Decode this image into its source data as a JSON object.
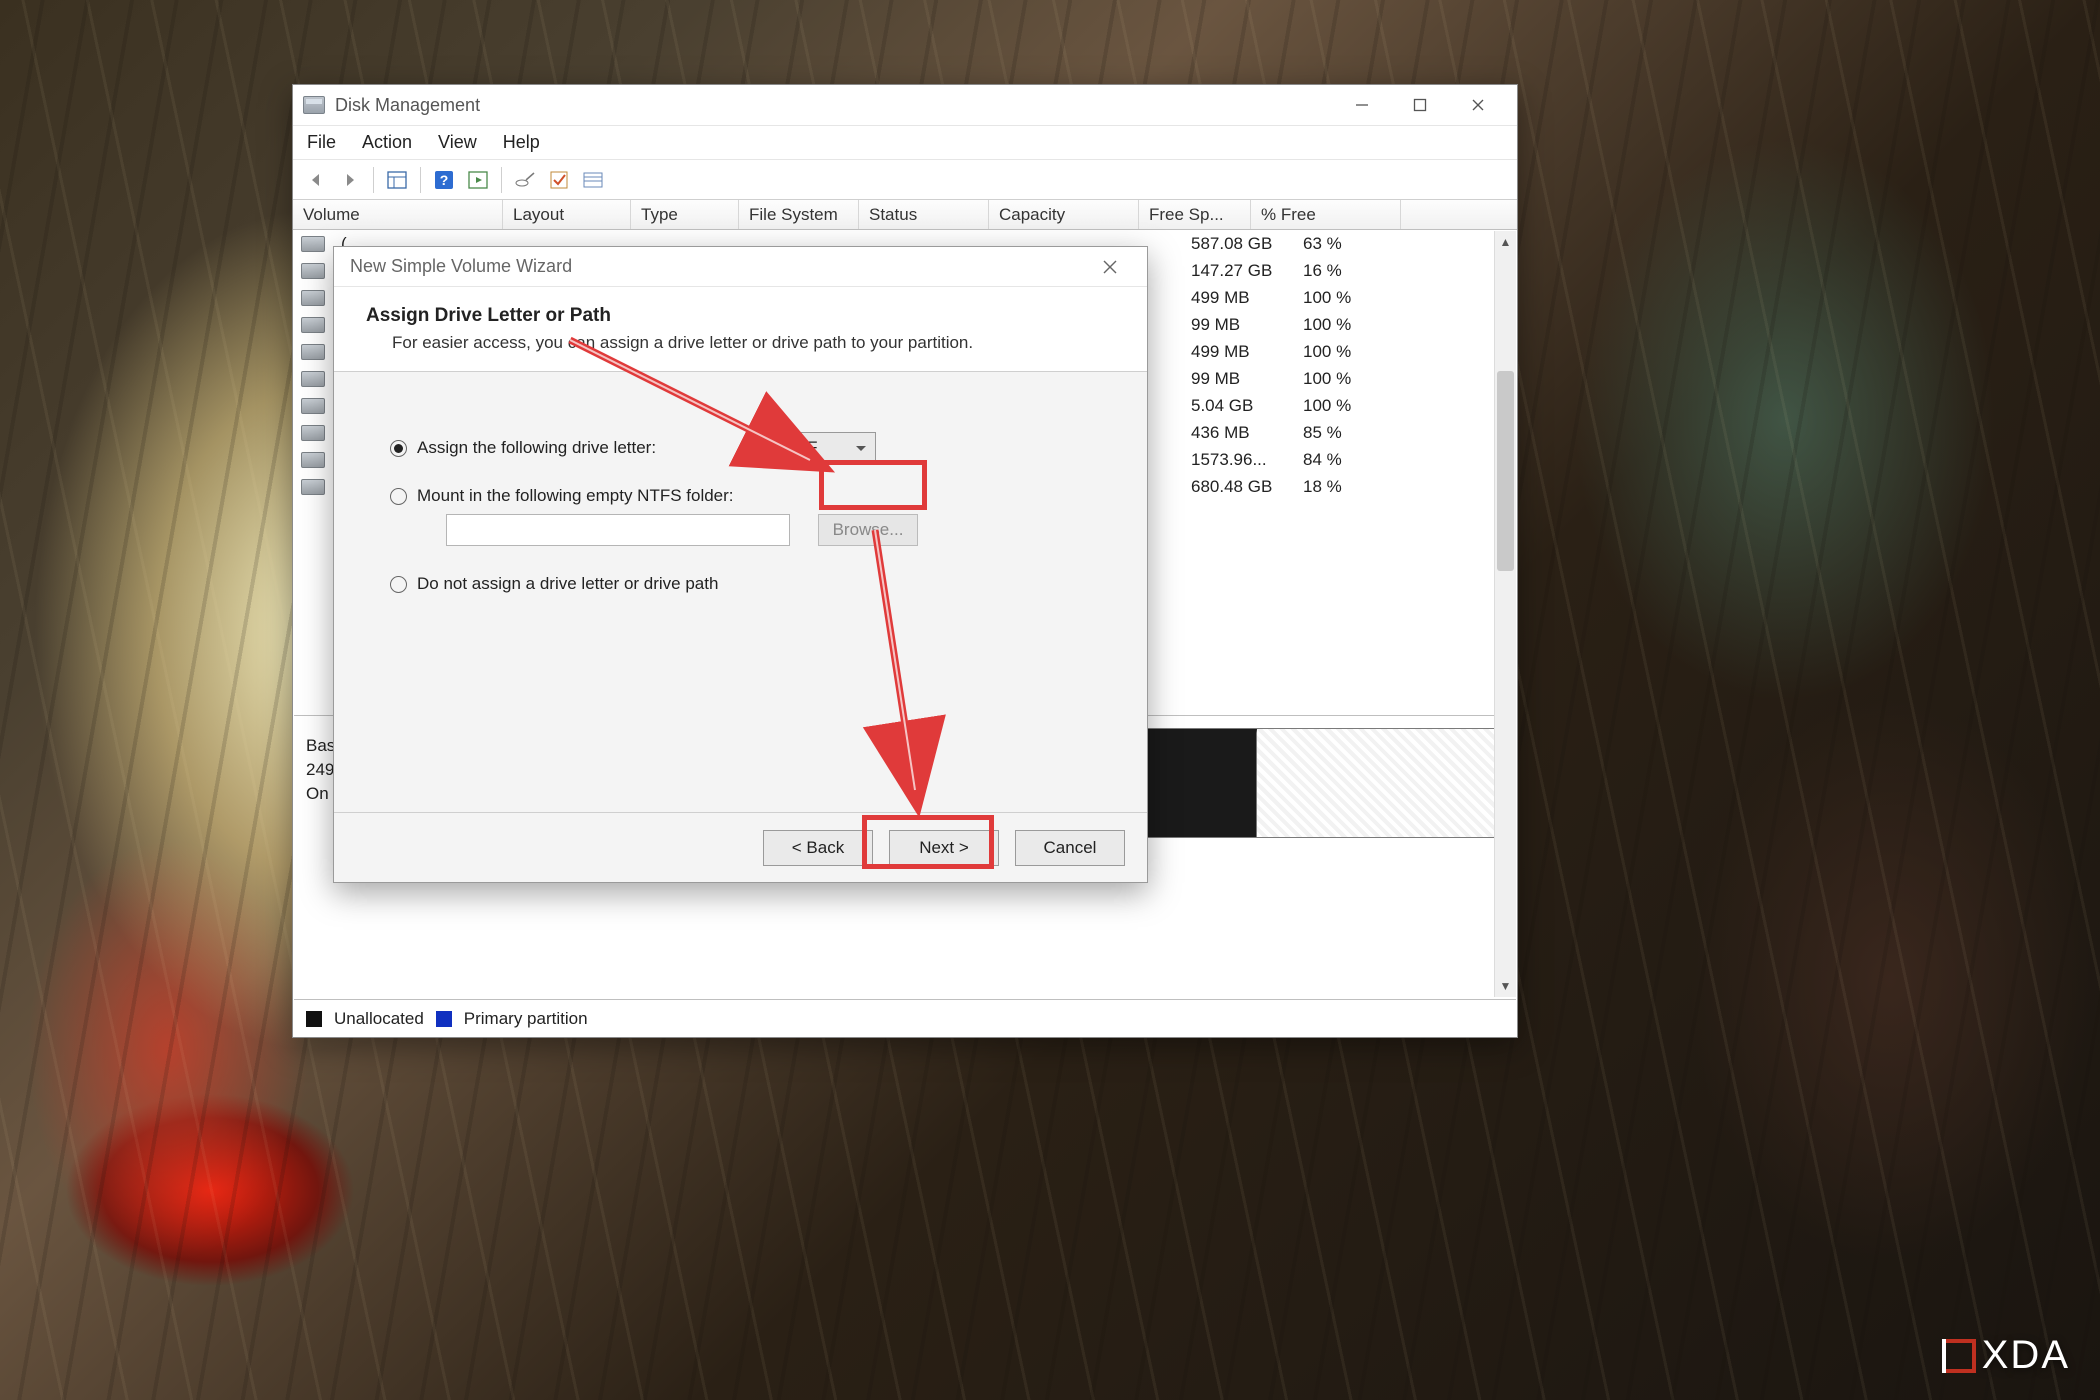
{
  "watermark": "XDA",
  "dm": {
    "title": "Disk Management",
    "menu": [
      "File",
      "Action",
      "View",
      "Help"
    ],
    "columns": [
      "Volume",
      "Layout",
      "Type",
      "File System",
      "Status",
      "Capacity",
      "Free Sp...",
      "% Free"
    ],
    "rows": [
      {
        "free": "587.08 GB",
        "pct": "63 %"
      },
      {
        "free": "147.27 GB",
        "pct": "16 %"
      },
      {
        "free": "499 MB",
        "pct": "100 %"
      },
      {
        "free": "99 MB",
        "pct": "100 %"
      },
      {
        "free": "499 MB",
        "pct": "100 %"
      },
      {
        "free": "99 MB",
        "pct": "100 %"
      },
      {
        "free": "5.04 GB",
        "pct": "100 %"
      },
      {
        "free": "436 MB",
        "pct": "85 %"
      },
      {
        "free": "1573.96...",
        "pct": "84 %"
      },
      {
        "free": "680.48 GB",
        "pct": "18 %"
      }
    ],
    "disk": {
      "line1": "Bas",
      "line2": "249",
      "line3": "On"
    },
    "legend": {
      "unalloc": "Unallocated",
      "primary": "Primary partition"
    }
  },
  "wizard": {
    "title": "New Simple Volume Wizard",
    "heading": "Assign Drive Letter or Path",
    "subtext": "For easier access, you can assign a drive letter or drive path to your partition.",
    "opt_assign": "Assign the following drive letter:",
    "drive_letter": "F",
    "opt_mount": "Mount in the following empty NTFS folder:",
    "browse": "Browse...",
    "opt_none": "Do not assign a drive letter or drive path",
    "back": "< Back",
    "next": "Next >",
    "cancel": "Cancel"
  }
}
